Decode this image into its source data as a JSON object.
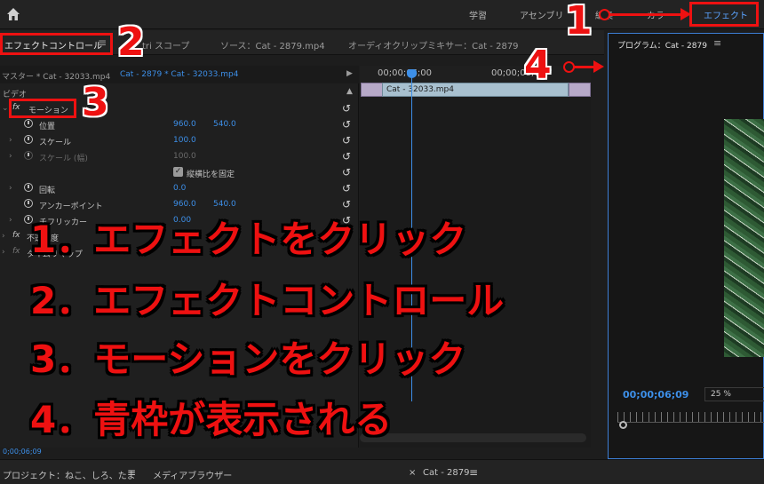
{
  "workspace_tabs": [
    "学習",
    "アセンブリ",
    "編集",
    "カラー",
    "エフェクト"
  ],
  "panel_tabs": {
    "effect_controls": "エフェクトコントロール",
    "lumetri": "tri スコープ",
    "source": "ソース：Cat - 2879.mp4",
    "audio_mixer": "オーディオクリップミキサー：Cat - 2879"
  },
  "sequence_row": {
    "master": "マスター * Cat - 32033.mp4",
    "sequence": "Cat - 2879 * Cat - 32033.mp4"
  },
  "timeline": {
    "timecode_a": "00;00;06;00",
    "timecode_b": "00;00;08;00",
    "clip_name": "Cat - 32033.mp4"
  },
  "effects": {
    "video_label": "ビデオ",
    "motion_label": "モーション",
    "fx_icon": "fx",
    "rows": [
      {
        "label": "位置",
        "v1": "960.0",
        "v2": "540.0"
      },
      {
        "label": "スケール",
        "v1": "100.0",
        "v2": ""
      },
      {
        "label": "スケール (幅)",
        "v1": "100.0",
        "v2": ""
      },
      {
        "label": "縦横比を固定",
        "v1": "",
        "v2": ""
      },
      {
        "label": "回転",
        "v1": "0.0",
        "v2": ""
      },
      {
        "label": "アンカーポイント",
        "v1": "960.0",
        "v2": "540.0"
      },
      {
        "label": "チフリッカー",
        "v1": "0.00",
        "v2": ""
      }
    ],
    "opacity_label": "不透明度",
    "time_remap_label": "タイムリマップ",
    "bottom_time": "0;00;06;09"
  },
  "program": {
    "title": "プログラム：Cat - 2879",
    "timecode": "00;00;06;09",
    "zoom": "25 %"
  },
  "bottom": {
    "project_tab": "プロジェクト：ねこ、しろ、たま",
    "media_browser_tab": "メディアブラウザー",
    "timeline_tab": "Cat - 2879"
  },
  "annotations": {
    "numbers": [
      "1",
      "2",
      "3",
      "4"
    ],
    "steps": [
      "1．エフェクトをクリック",
      "2．エフェクトコントロール",
      "3．モーションをクリック",
      "4．青枠が表示される"
    ]
  },
  "colors": {
    "accent_blue": "#3d8fe8",
    "annotation_red": "#ee1111"
  }
}
